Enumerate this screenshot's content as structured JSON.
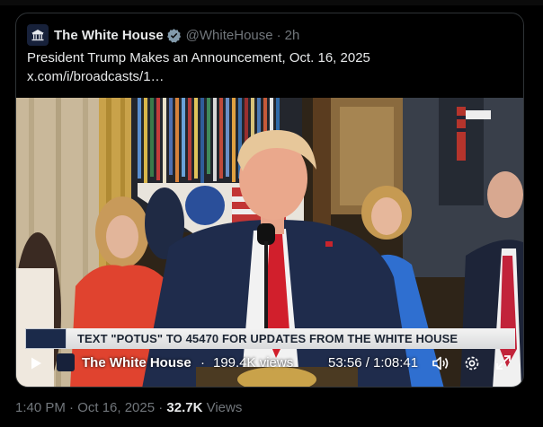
{
  "post": {
    "author_name": "The White House",
    "handle": "@WhiteHouse",
    "separator": "·",
    "relative_time": "2h",
    "text_prefix": "President Trump Makes an Announcement, Oct. 16, 2025 ",
    "link_text": "x.com/i/broadcasts/1…",
    "verified_badge_icon": "verified-badge-icon",
    "badge_color": "#829aab"
  },
  "video": {
    "ticker_text": "TEXT \"POTUS\" TO 45470 FOR UPDATES FROM THE WHITE HOUSE",
    "controls": {
      "channel_name": "The White House",
      "separator": "·",
      "views": "199.4K views",
      "time": "53:56 / 1:08:41",
      "icons": [
        "play-icon",
        "volume-icon",
        "settings-gear-icon",
        "fullscreen-icon"
      ]
    }
  },
  "footer": {
    "timestamp": "1:40 PM · Oct 16, 2025 · ",
    "view_count": "32.7K",
    "views_label": " Views"
  }
}
